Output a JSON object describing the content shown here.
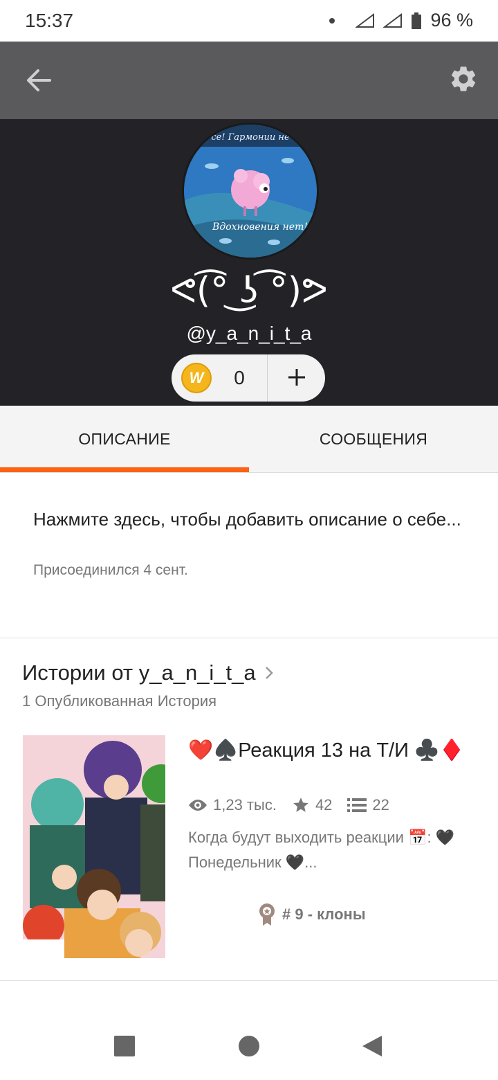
{
  "status_bar": {
    "time": "15:37",
    "battery": "96 %"
  },
  "profile": {
    "display_name": "ᕙ(͡° ͜ʖ ͡°)ᕗ",
    "username": "@y_a_n_i_t_a",
    "coins": "0",
    "avatar_caption_top": "се! Гармонии не",
    "avatar_caption_bottom": "Вдохновения нет!"
  },
  "tabs": [
    {
      "label": "ОПИСАНИЕ"
    },
    {
      "label": "СООБЩЕНИЯ"
    }
  ],
  "about": {
    "description": "Нажмите здесь, чтобы добавить описание о себе...",
    "joined": "Присоединился 4 сент."
  },
  "stories": {
    "heading": "Истории от y_a_n_i_t_a",
    "count": "1 Опубликованная История",
    "items": [
      {
        "title": "❤️♠️Реакция 13 на Т/И ♣️♦️",
        "reads": "1,23 тыс.",
        "votes": "42",
        "parts": "22",
        "description": "Когда будут выходить реакции 📅: 🖤Понедельник 🖤...",
        "rank": "# 9 - клоны"
      }
    ]
  },
  "colors": {
    "accent": "#ff6212",
    "appbar": "#5a5a5c",
    "header": "#232226"
  }
}
